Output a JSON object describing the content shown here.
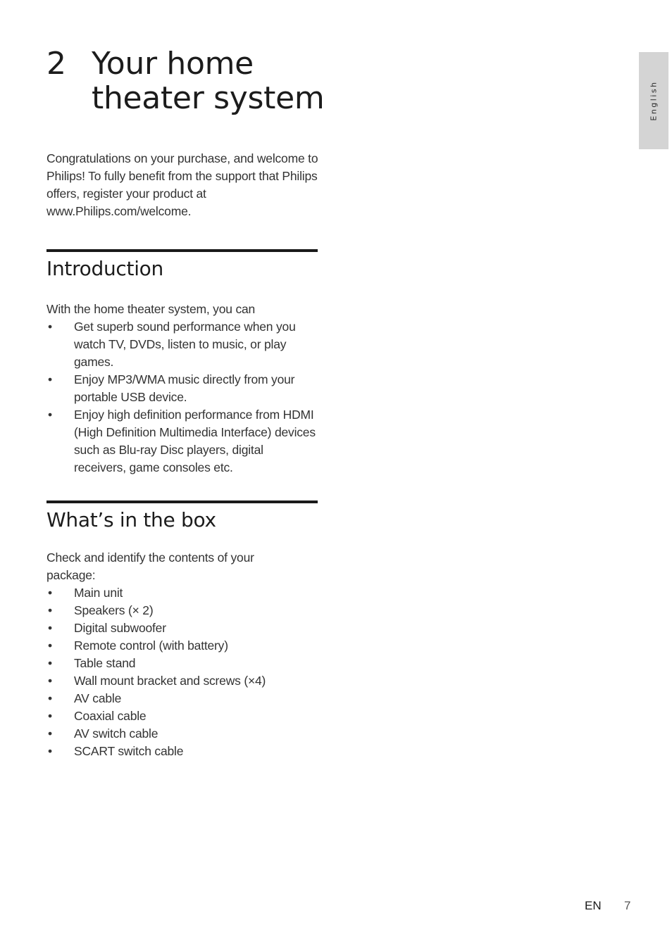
{
  "chapter": {
    "number": "2",
    "title": "Your home theater system"
  },
  "language_tab": "English",
  "intro_paragraph": "Congratulations on your purchase, and welcome to Philips! To fully benefit from the support that Philips offers, register your product at www.Philips.com/welcome.",
  "sections": {
    "introduction": {
      "title": "Introduction",
      "lead": "With the home theater system, you can",
      "bullet_glyph": "•",
      "items": [
        "Get superb sound performance when you watch TV, DVDs, listen to music, or play games.",
        "Enjoy MP3/WMA music directly from your portable USB device.",
        "Enjoy high definition performance from HDMI (High Definition Multimedia Interface) devices such as Blu-ray Disc players, digital receivers, game consoles etc."
      ]
    },
    "whats_in_the_box": {
      "title": "What’s in the box",
      "lead": "Check and identify the contents of your package:",
      "bullet_glyph": "•",
      "items": [
        "Main unit",
        "Speakers (× 2)",
        "Digital subwoofer",
        "Remote control (with battery)",
        "Table stand",
        "Wall mount bracket and screws (×4)",
        "AV cable",
        "Coaxial cable",
        "AV switch cable",
        "SCART switch cable"
      ]
    }
  },
  "footer": {
    "language_code": "EN",
    "page_number": "7"
  }
}
